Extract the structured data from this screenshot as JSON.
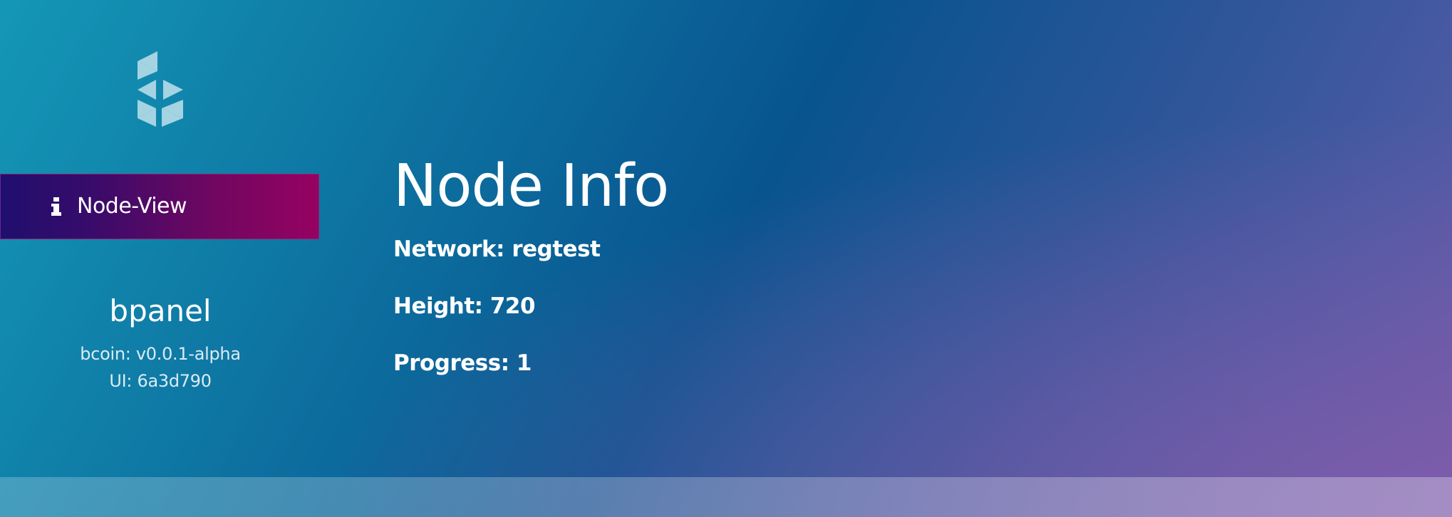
{
  "sidebar": {
    "logo": "bcoin-logo",
    "items": [
      {
        "icon": "info-icon",
        "label": "Node-View"
      }
    ],
    "brand": {
      "name": "bpanel",
      "version": "bcoin: v0.0.1-alpha",
      "ui": "UI: 6a3d790"
    }
  },
  "main": {
    "title": "Node Info",
    "network": "Network: regtest",
    "height": "Height: 720",
    "progress": "Progress: 1"
  },
  "colors": {
    "nav_active_start": "#1f0f6e",
    "nav_active_end": "#960261",
    "background_start": "#1497b6",
    "background_end": "#6a5aa8"
  }
}
